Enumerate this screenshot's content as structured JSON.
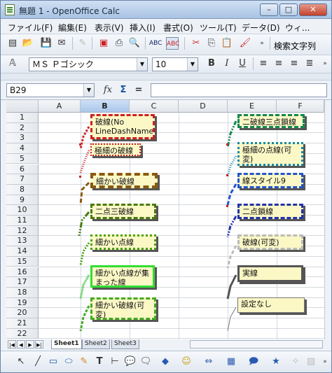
{
  "window": {
    "title": "無題 1 - OpenOffice Calc"
  },
  "menu": [
    "ファイル(F)",
    "編集(E)",
    "表示(V)",
    "挿入(I)",
    "書式(O)",
    "ツール(T)",
    "データ(D)",
    "ウィ..."
  ],
  "toolbar": {
    "search_label": "検索文字列"
  },
  "format": {
    "font_name": "ＭＳ Ｐゴシック",
    "font_size": "10",
    "bold": "B",
    "italic": "I",
    "underline": "U"
  },
  "formula": {
    "cell_ref": "B29",
    "fx": "𝑓x",
    "sum": "Σ",
    "equals": "="
  },
  "columns": [
    "A",
    "B",
    "C",
    "D",
    "E",
    "F"
  ],
  "rows": [
    "1",
    "2",
    "3",
    "4",
    "5",
    "6",
    "7",
    "8",
    "9",
    "10",
    "11",
    "12",
    "13",
    "14",
    "15",
    "16",
    "17",
    "18",
    "19",
    "20",
    "21",
    "22"
  ],
  "callouts": [
    "破線(No LineDashName)",
    "極細の破線",
    "細かい破線",
    "二点三破線",
    "細かい点線",
    "細かい点線が集まった線",
    "細かい破線(可変)",
    "二破線三点鎖線",
    "極細の点線(可変)",
    "線スタイル9",
    "二点鎖線",
    "破線(可変)",
    "実線",
    "設定なし"
  ],
  "sheets": [
    "Sheet1",
    "Sheet2",
    "Sheet3"
  ],
  "colors": {
    "selection": "#a9c6ea",
    "callout_fill": "#fbf8c6"
  }
}
